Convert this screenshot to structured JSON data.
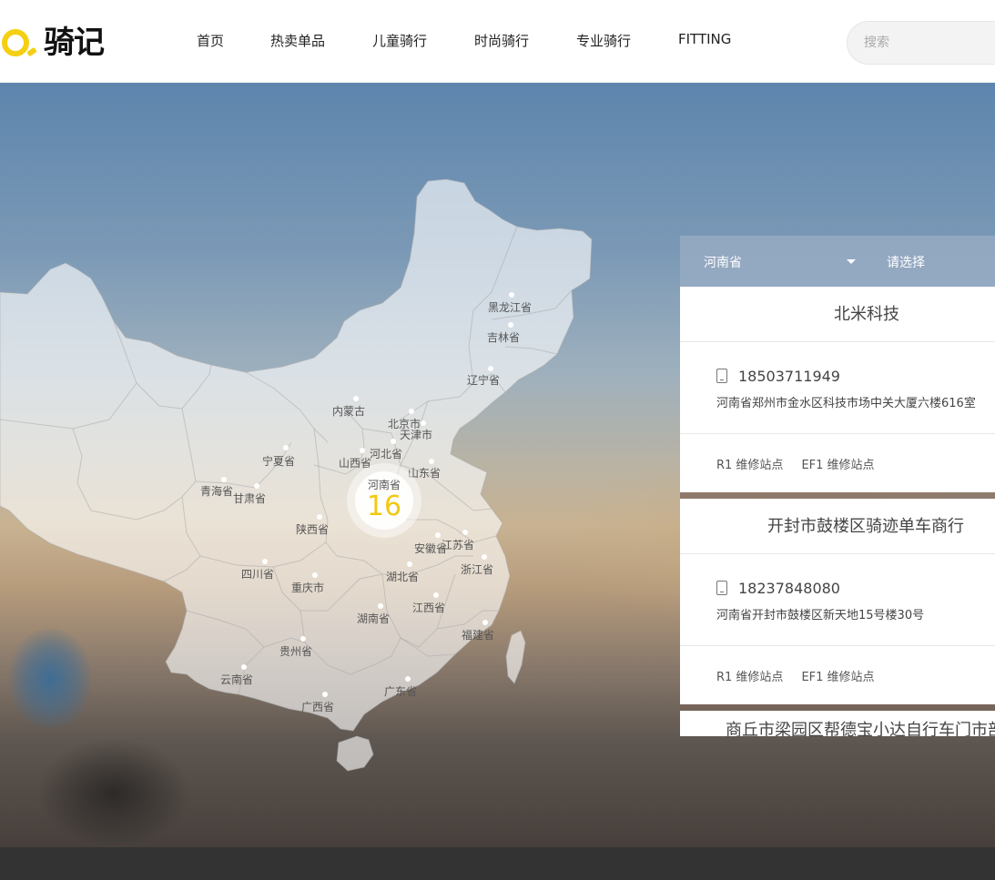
{
  "header": {
    "logo_text": "骑记",
    "nav": [
      "首页",
      "热卖单品",
      "儿童骑行",
      "时尚骑行",
      "专业骑行",
      "FITTING"
    ],
    "search_placeholder": "搜索"
  },
  "map": {
    "provinces": [
      {
        "name": "黑龙江省"
      },
      {
        "name": "吉林省"
      },
      {
        "name": "辽宁省"
      },
      {
        "name": "内蒙古"
      },
      {
        "name": "北京市"
      },
      {
        "name": "天津市"
      },
      {
        "name": "河北省"
      },
      {
        "name": "宁夏省"
      },
      {
        "name": "山西省"
      },
      {
        "name": "山东省"
      },
      {
        "name": "青海省"
      },
      {
        "name": "甘肃省"
      },
      {
        "name": "陕西省"
      },
      {
        "name": "江苏省"
      },
      {
        "name": "安徽省"
      },
      {
        "name": "四川省"
      },
      {
        "name": "浙江省"
      },
      {
        "name": "湖北省"
      },
      {
        "name": "重庆市"
      },
      {
        "name": "江西省"
      },
      {
        "name": "湖南省"
      },
      {
        "name": "福建省"
      },
      {
        "name": "贵州省"
      },
      {
        "name": "云南省"
      },
      {
        "name": "广东省"
      },
      {
        "name": "广西省"
      }
    ],
    "highlight": {
      "name": "河南省",
      "count": "16"
    }
  },
  "panel": {
    "province_select": "河南省",
    "city_select": "请选择",
    "stores": [
      {
        "title": "北米科技",
        "phone": "18503711949",
        "address": "河南省郑州市金水区科技市场中关大厦六楼616室",
        "tags": [
          "R1 维修站点",
          "EF1 维修站点"
        ]
      },
      {
        "title": "开封市鼓楼区骑迹单车商行",
        "phone": "18237848080",
        "address": "河南省开封市鼓楼区新天地15号楼30号",
        "tags": [
          "R1 维修站点",
          "EF1 维修站点"
        ]
      },
      {
        "title": "商丘市梁园区帮德宝小达自行车门市部"
      }
    ]
  }
}
